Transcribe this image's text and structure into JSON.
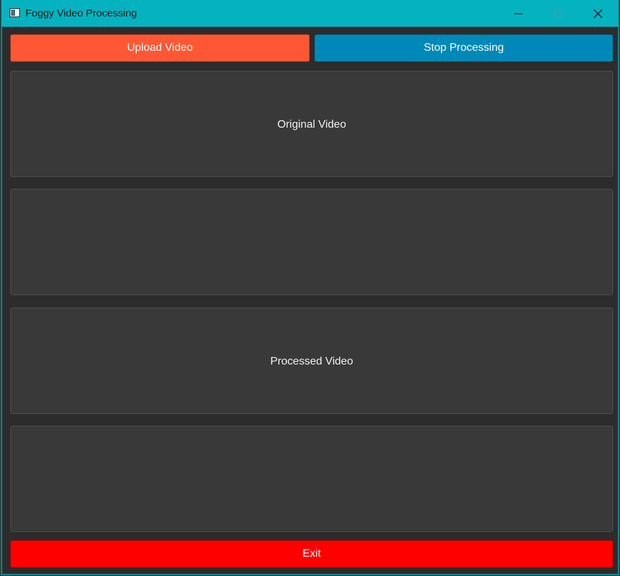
{
  "window": {
    "title": "Foggy Video Processing",
    "icons": {
      "app": "app-window-icon",
      "minimize": "minimize-icon",
      "maximize": "maximize-icon",
      "close": "close-icon"
    }
  },
  "toolbar": {
    "upload_label": "Upload Video",
    "stop_label": "Stop Processing"
  },
  "panels": {
    "original_label": "Original Video",
    "processed_label": "Processed Video"
  },
  "footer": {
    "exit_label": "Exit"
  },
  "colors": {
    "titlebar": "#05b3c0",
    "upload_button": "#ff5733",
    "stop_button": "#0089b8",
    "exit_button": "#ff0000",
    "panel": "#393939",
    "background": "#2c2c2c"
  }
}
